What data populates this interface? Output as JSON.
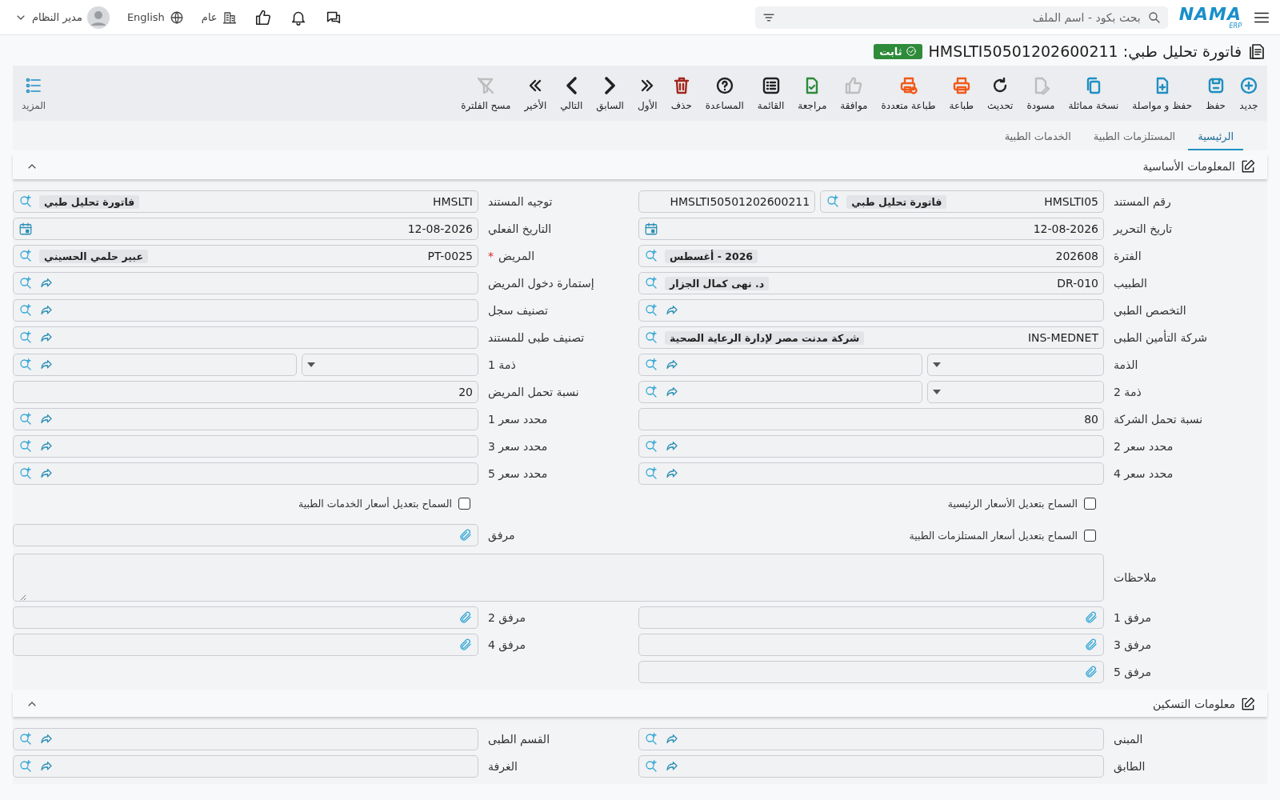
{
  "header": {
    "logo": {
      "name": "NAMA",
      "sub": "ERP"
    },
    "search": {
      "placeholder": "بحث بكود - اسم الملف"
    },
    "company": "عام",
    "language": "English",
    "user": "مدير النظام"
  },
  "title": {
    "text": "فاتورة تحليل طبي: HMSLTI50501202600211",
    "status": "ثابت"
  },
  "toolbar": [
    {
      "label": "جديد",
      "color": "#1f8fc2"
    },
    {
      "label": "حفظ",
      "color": "#1f8fc2"
    },
    {
      "label": "حفظ و مواصلة",
      "color": "#1f8fc2"
    },
    {
      "label": "نسخة مماثلة",
      "color": "#1f8fc2"
    },
    {
      "label": "مسودة",
      "color": "#bdbdbd"
    },
    {
      "label": "تحديث",
      "color": "#222222"
    },
    {
      "label": "طباعة",
      "color": "#f05a1a"
    },
    {
      "label": "طباعة متعددة",
      "color": "#f05a1a"
    },
    {
      "label": "موافقة",
      "color": "#bdbdbd"
    },
    {
      "label": "مراجعة",
      "color": "#2e8b3a"
    },
    {
      "label": "القائمة",
      "color": "#222222"
    },
    {
      "label": "المساعدة",
      "color": "#222222"
    },
    {
      "label": "حذف",
      "color": "#a3261b"
    },
    {
      "label": "الأول",
      "color": "#222222"
    },
    {
      "label": "السابق",
      "color": "#222222"
    },
    {
      "label": "التالي",
      "color": "#222222"
    },
    {
      "label": "الأخير",
      "color": "#222222"
    },
    {
      "label": "مسح الفلترة",
      "color": "#bdbdbd"
    }
  ],
  "more_button": {
    "label": "المزيد"
  },
  "tabs": [
    {
      "label": "الرئيسية",
      "selected": true
    },
    {
      "label": "المستلزمات الطبية",
      "selected": false
    },
    {
      "label": "الخدمات الطبية",
      "selected": false
    }
  ],
  "sections": [
    {
      "title": "المعلومات الأساسية",
      "expanded": true,
      "fields": [
        {
          "kind": "docno",
          "label": "رقم المستند",
          "value": "HMSLTI05",
          "tag": "فاتورة تحليل طبي",
          "number": "HMSLTI50501202600211"
        },
        {
          "kind": "lookup",
          "label": "توجيه المستند",
          "value": "HMSLTI",
          "tag": "فاتورة تحليل طبي"
        },
        {
          "kind": "date",
          "label": "تاريخ التحرير",
          "value": "12-08-2026"
        },
        {
          "kind": "date",
          "label": "التاريخ الفعلي",
          "value": "12-08-2026"
        },
        {
          "kind": "lookup",
          "label": "الفترة",
          "value": "202608",
          "tag": "2026 - أغسطس"
        },
        {
          "kind": "lookup",
          "label": "المريض",
          "value": "PT-0025",
          "tag": "عبير حلمي الحسيني",
          "required_mark": "*"
        },
        {
          "kind": "lookup",
          "label": "الطبيب",
          "value": "DR-010",
          "tag": "د. نهى كمال الجزار"
        },
        {
          "kind": "lookup",
          "label": "إستمارة دخول المريض"
        },
        {
          "kind": "lookup",
          "label": "التخصص الطبي"
        },
        {
          "kind": "lookup",
          "label": "تصنيف سجل"
        },
        {
          "kind": "lookup",
          "label": "شركة التأمين الطبى",
          "value": "INS-MEDNET",
          "tag": "شركة مدنت مصر لإدارة الرعاية الصحية"
        },
        {
          "kind": "lookup",
          "label": "تصنيف طبى للمستند"
        },
        {
          "kind": "select_lookup",
          "label": "الذمة"
        },
        {
          "kind": "select_lookup",
          "label": "ذمة 1"
        },
        {
          "kind": "select_lookup",
          "label": "ذمة 2"
        },
        {
          "kind": "text",
          "label": "نسبة تحمل المريض",
          "value": "20"
        },
        {
          "kind": "text",
          "label": "نسبة تحمل الشركة",
          "value": "80"
        },
        {
          "kind": "lookup",
          "label": "محدد سعر 1"
        },
        {
          "kind": "lookup",
          "label": "محدد سعر 2"
        },
        {
          "kind": "lookup",
          "label": "محدد سعر 3"
        },
        {
          "kind": "lookup",
          "label": "محدد سعر 4"
        },
        {
          "kind": "lookup",
          "label": "محدد سعر 5"
        },
        {
          "kind": "checkbox",
          "label": "السماح بتعديل الأسعار الرئيسية",
          "checked": false
        },
        {
          "kind": "checkbox",
          "label": "السماح بتعديل أسعار الخدمات الطبية",
          "checked": false
        },
        {
          "kind": "checkbox",
          "label": "السماح بتعديل أسعار المستلزمات الطبية",
          "checked": false
        },
        {
          "kind": "attachment",
          "label": "مرفق"
        },
        {
          "kind": "notes",
          "label": "ملاحظات"
        },
        {
          "kind": "attachment",
          "label": "مرفق 1"
        },
        {
          "kind": "attachment",
          "label": "مرفق 2"
        },
        {
          "kind": "attachment",
          "label": "مرفق 3"
        },
        {
          "kind": "attachment",
          "label": "مرفق 4"
        },
        {
          "kind": "attachment",
          "label": "مرفق 5"
        }
      ]
    },
    {
      "title": "معلومات التسكين",
      "expanded": true,
      "fields": [
        {
          "kind": "lookup",
          "label": "المبنى"
        },
        {
          "kind": "lookup",
          "label": "القسم الطبى"
        },
        {
          "kind": "lookup",
          "label": "الطابق"
        },
        {
          "kind": "lookup",
          "label": "الغرفة"
        }
      ]
    }
  ]
}
